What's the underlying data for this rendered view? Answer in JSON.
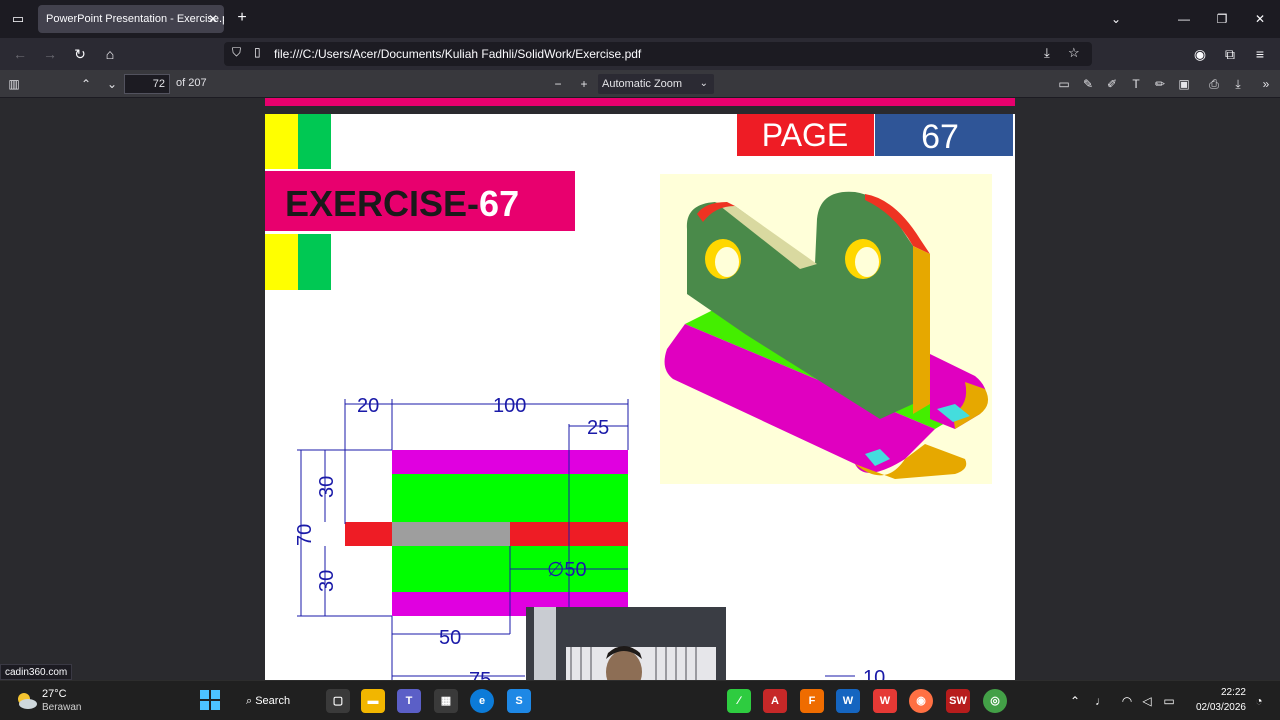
{
  "browser": {
    "tab_title": "PowerPoint Presentation - Exercise.pdf",
    "url": "file:///C:/Users/Acer/Documents/Kuliah Fadhli/SolidWork/Exercise.pdf"
  },
  "pdf_toolbar": {
    "page_number": "72",
    "page_total": "of 207",
    "zoom": "Automatic Zoom"
  },
  "document": {
    "page_label": "PAGE",
    "page_value": "67",
    "exercise_prefix": "EXERCISE-",
    "exercise_number": "67",
    "dimensions": {
      "d20": "20",
      "d100": "100",
      "d25": "25",
      "d30a": "30",
      "d70": "70",
      "d30b": "30",
      "dia50": "∅50",
      "d50": "50",
      "d75": "75",
      "d10": "10"
    }
  },
  "status_tip": "cadin360.com",
  "taskbar": {
    "temperature": "27°C",
    "weather": "Berawan",
    "search_label": "Search",
    "time": "22:22",
    "date": "02/03/2026"
  },
  "colors": {
    "magenta": "#e8006e",
    "yellow": "#ffff00",
    "green": "#00c853",
    "red": "#ee1c25",
    "blue": "#2f5597",
    "bright_green": "#00ff00",
    "purple": "#e000e0",
    "dim_blue": "#1a1aa8"
  }
}
